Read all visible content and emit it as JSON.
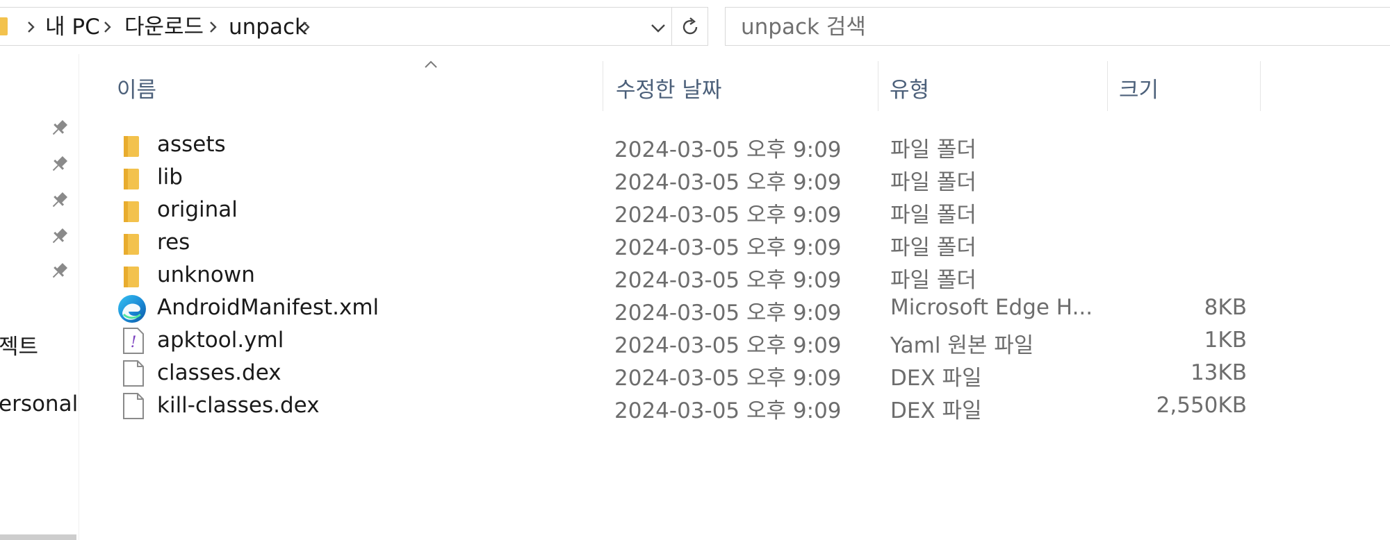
{
  "address_bar": {
    "crumbs": [
      "내 PC",
      "다운로드",
      "unpack"
    ]
  },
  "search": {
    "placeholder": "unpack 검색"
  },
  "nav_pane": {
    "partial_labels": [
      "젝트",
      "ersonal"
    ]
  },
  "columns": {
    "name": "이름",
    "modified": "수정한 날짜",
    "type": "유형",
    "size": "크기"
  },
  "files": [
    {
      "name": "assets",
      "modified": "2024-03-05 오후 9:09",
      "type": "파일 폴더",
      "size": "",
      "icon": "folder-icon"
    },
    {
      "name": "lib",
      "modified": "2024-03-05 오후 9:09",
      "type": "파일 폴더",
      "size": "",
      "icon": "folder-icon"
    },
    {
      "name": "original",
      "modified": "2024-03-05 오후 9:09",
      "type": "파일 폴더",
      "size": "",
      "icon": "folder-icon"
    },
    {
      "name": "res",
      "modified": "2024-03-05 오후 9:09",
      "type": "파일 폴더",
      "size": "",
      "icon": "folder-icon"
    },
    {
      "name": "unknown",
      "modified": "2024-03-05 오후 9:09",
      "type": "파일 폴더",
      "size": "",
      "icon": "folder-icon"
    },
    {
      "name": "AndroidManifest.xml",
      "modified": "2024-03-05 오후 9:09",
      "type": "Microsoft Edge H...",
      "size": "8KB",
      "icon": "edge-icon"
    },
    {
      "name": "apktool.yml",
      "modified": "2024-03-05 오후 9:09",
      "type": "Yaml 원본 파일",
      "size": "1KB",
      "icon": "yaml-file-icon"
    },
    {
      "name": "classes.dex",
      "modified": "2024-03-05 오후 9:09",
      "type": "DEX 파일",
      "size": "13KB",
      "icon": "file-icon"
    },
    {
      "name": "kill-classes.dex",
      "modified": "2024-03-05 오후 9:09",
      "type": "DEX 파일",
      "size": "2,550KB",
      "icon": "file-icon"
    }
  ],
  "colors": {
    "folder": "#f3c24d",
    "header_text": "#4c607a",
    "secondary_text": "#6d6d6d"
  }
}
